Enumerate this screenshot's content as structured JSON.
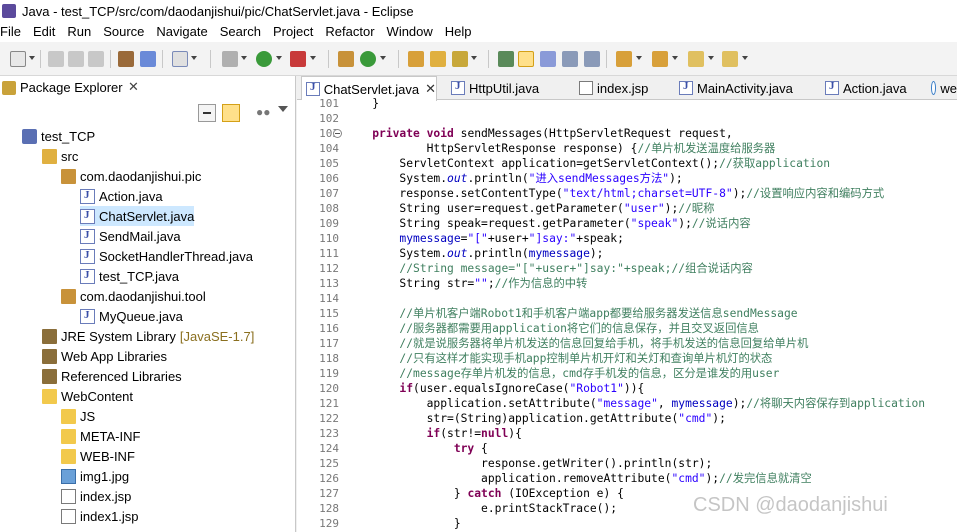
{
  "window": {
    "title": "Java - test_TCP/src/com/daodanjishui/pic/ChatServlet.java - Eclipse"
  },
  "menu": [
    "File",
    "Edit",
    "Run",
    "Source",
    "Navigate",
    "Search",
    "Project",
    "Refactor",
    "Window",
    "Help"
  ],
  "toolbar_icons": [
    "new-icon",
    "save-icon",
    "save-all-icon",
    "print-icon",
    "build-icon",
    "task-icon",
    "new-java-project-icon",
    "debug-icon",
    "run-icon",
    "external-tools-icon",
    "new-package-icon",
    "new-class-icon",
    "open-type-icon",
    "search-icon",
    "toggle-mark-icon",
    "highlight-icon",
    "show-whitespace-icon",
    "show-block-icon",
    "next-annotation-icon",
    "prev-annotation-icon",
    "back-icon",
    "forward-icon"
  ],
  "explorer": {
    "tab_label": "Package Explorer",
    "tree": [
      {
        "label": "test_TCP",
        "icon": "project-icon"
      },
      {
        "label": "src",
        "icon": "source-folder-icon"
      },
      {
        "label": "com.daodanjishui.pic",
        "icon": "package-icon"
      },
      {
        "label": "Action.java",
        "icon": "java-file-icon"
      },
      {
        "label": "ChatServlet.java",
        "icon": "java-file-icon"
      },
      {
        "label": "SendMail.java",
        "icon": "java-file-icon"
      },
      {
        "label": "SocketHandlerThread.java",
        "icon": "java-file-icon"
      },
      {
        "label": "test_TCP.java",
        "icon": "java-file-icon"
      },
      {
        "label": "com.daodanjishui.tool",
        "icon": "package-icon"
      },
      {
        "label": "MyQueue.java",
        "icon": "java-file-icon"
      },
      {
        "label": "JRE System Library",
        "suffix": "[JavaSE-1.7]",
        "icon": "library-icon"
      },
      {
        "label": "Web App Libraries",
        "icon": "library-icon"
      },
      {
        "label": "Referenced Libraries",
        "icon": "library-icon"
      },
      {
        "label": "WebContent",
        "icon": "folder-icon"
      },
      {
        "label": "JS",
        "icon": "folder-icon"
      },
      {
        "label": "META-INF",
        "icon": "folder-icon"
      },
      {
        "label": "WEB-INF",
        "icon": "folder-icon"
      },
      {
        "label": "img1.jpg",
        "icon": "image-file-icon"
      },
      {
        "label": "index.jsp",
        "icon": "jsp-file-icon"
      },
      {
        "label": "index1.jsp",
        "icon": "jsp-file-icon"
      }
    ]
  },
  "editor": {
    "tabs": [
      {
        "label": "ChatServlet.java",
        "active": true
      },
      {
        "label": "HttpUtil.java"
      },
      {
        "label": "index.jsp"
      },
      {
        "label": "MainActivity.java"
      },
      {
        "label": "Action.java"
      },
      {
        "label": "we"
      }
    ],
    "lines": [
      {
        "num": "101",
        "parts": [
          {
            "t": "    }",
            "c": ""
          }
        ]
      },
      {
        "num": "102",
        "parts": [
          {
            "t": "",
            "c": ""
          }
        ]
      },
      {
        "num": "103",
        "parts": [
          {
            "t": "    ",
            "c": ""
          },
          {
            "t": "private void",
            "c": "kw"
          },
          {
            "t": " sendMessages(HttpServletRequest request,",
            "c": ""
          }
        ]
      },
      {
        "num": "104",
        "parts": [
          {
            "t": "            HttpServletResponse response) {",
            "c": ""
          },
          {
            "t": "//单片机发送温度给服务器",
            "c": "cm"
          }
        ]
      },
      {
        "num": "105",
        "parts": [
          {
            "t": "        ServletContext application=getServletContext();",
            "c": ""
          },
          {
            "t": "//获取application",
            "c": "cm"
          }
        ]
      },
      {
        "num": "106",
        "parts": [
          {
            "t": "        System.",
            "c": ""
          },
          {
            "t": "out",
            "c": "sfld"
          },
          {
            "t": ".println(",
            "c": ""
          },
          {
            "t": "\"进入sendMessages方法\"",
            "c": "str"
          },
          {
            "t": ");",
            "c": ""
          }
        ]
      },
      {
        "num": "107",
        "parts": [
          {
            "t": "        response.setContentType(",
            "c": ""
          },
          {
            "t": "\"text/html;charset=UTF-8\"",
            "c": "str"
          },
          {
            "t": ");",
            "c": ""
          },
          {
            "t": "//设置响应内容和编码方式",
            "c": "cm"
          }
        ]
      },
      {
        "num": "108",
        "parts": [
          {
            "t": "        String user=request.getParameter(",
            "c": ""
          },
          {
            "t": "\"user\"",
            "c": "str"
          },
          {
            "t": ");",
            "c": ""
          },
          {
            "t": "//昵称",
            "c": "cm"
          }
        ]
      },
      {
        "num": "109",
        "parts": [
          {
            "t": "        String speak=request.getParameter(",
            "c": ""
          },
          {
            "t": "\"speak\"",
            "c": "str"
          },
          {
            "t": ");",
            "c": ""
          },
          {
            "t": "//说话内容",
            "c": "cm"
          }
        ]
      },
      {
        "num": "110",
        "parts": [
          {
            "t": "        ",
            "c": ""
          },
          {
            "t": "mymessage",
            "c": "fld"
          },
          {
            "t": "=",
            "c": ""
          },
          {
            "t": "\"[\"",
            "c": "str"
          },
          {
            "t": "+user+",
            "c": ""
          },
          {
            "t": "\"]say:\"",
            "c": "str"
          },
          {
            "t": "+speak;",
            "c": ""
          }
        ]
      },
      {
        "num": "111",
        "parts": [
          {
            "t": "        System.",
            "c": ""
          },
          {
            "t": "out",
            "c": "sfld"
          },
          {
            "t": ".println(",
            "c": ""
          },
          {
            "t": "mymessage",
            "c": "fld"
          },
          {
            "t": ");",
            "c": ""
          }
        ]
      },
      {
        "num": "112",
        "parts": [
          {
            "t": "        ",
            "c": ""
          },
          {
            "t": "//String message=\"[\"+user+\"]say:\"+speak;//组合说话内容",
            "c": "cm"
          }
        ]
      },
      {
        "num": "113",
        "parts": [
          {
            "t": "        String str=",
            "c": ""
          },
          {
            "t": "\"\"",
            "c": "str"
          },
          {
            "t": ";",
            "c": ""
          },
          {
            "t": "//作为信息的中转",
            "c": "cm"
          }
        ]
      },
      {
        "num": "114",
        "parts": [
          {
            "t": "",
            "c": ""
          }
        ]
      },
      {
        "num": "115",
        "parts": [
          {
            "t": "        ",
            "c": ""
          },
          {
            "t": "//单片机客户端Robot1和手机客户端app都要给服务器发送信息sendMessage",
            "c": "cm"
          }
        ]
      },
      {
        "num": "116",
        "parts": [
          {
            "t": "        ",
            "c": ""
          },
          {
            "t": "//服务器都需要用application将它们的信息保存，并且交叉返回信息",
            "c": "cm"
          }
        ]
      },
      {
        "num": "117",
        "parts": [
          {
            "t": "        ",
            "c": ""
          },
          {
            "t": "//就是说服务器将单片机发送的信息回复给手机，将手机发送的信息回复给单片机",
            "c": "cm"
          }
        ]
      },
      {
        "num": "118",
        "parts": [
          {
            "t": "        ",
            "c": ""
          },
          {
            "t": "//只有这样才能实现手机app控制单片机开灯和关灯和查询单片机灯的状态",
            "c": "cm"
          }
        ]
      },
      {
        "num": "119",
        "parts": [
          {
            "t": "        ",
            "c": ""
          },
          {
            "t": "//message存单片机发的信息，cmd存手机发的信息，区分是谁发的用user",
            "c": "cm"
          }
        ]
      },
      {
        "num": "120",
        "parts": [
          {
            "t": "        ",
            "c": ""
          },
          {
            "t": "if",
            "c": "kw"
          },
          {
            "t": "(user.equalsIgnoreCase(",
            "c": ""
          },
          {
            "t": "\"Robot1\"",
            "c": "str"
          },
          {
            "t": ")){",
            "c": ""
          }
        ]
      },
      {
        "num": "121",
        "parts": [
          {
            "t": "            application.setAttribute(",
            "c": ""
          },
          {
            "t": "\"message\"",
            "c": "str"
          },
          {
            "t": ", ",
            "c": ""
          },
          {
            "t": "mymessage",
            "c": "fld"
          },
          {
            "t": ");",
            "c": ""
          },
          {
            "t": "//将聊天内容保存到application",
            "c": "cm"
          }
        ]
      },
      {
        "num": "122",
        "parts": [
          {
            "t": "            str=(String)application.getAttribute(",
            "c": ""
          },
          {
            "t": "\"cmd\"",
            "c": "str"
          },
          {
            "t": ");",
            "c": ""
          }
        ]
      },
      {
        "num": "123",
        "parts": [
          {
            "t": "            ",
            "c": ""
          },
          {
            "t": "if",
            "c": "kw"
          },
          {
            "t": "(str!=",
            "c": ""
          },
          {
            "t": "null",
            "c": "kw"
          },
          {
            "t": "){",
            "c": ""
          }
        ]
      },
      {
        "num": "124",
        "parts": [
          {
            "t": "                ",
            "c": ""
          },
          {
            "t": "try",
            "c": "kw"
          },
          {
            "t": " {",
            "c": ""
          }
        ]
      },
      {
        "num": "125",
        "parts": [
          {
            "t": "                    response.getWriter().println(str);",
            "c": ""
          }
        ]
      },
      {
        "num": "126",
        "parts": [
          {
            "t": "                    application.removeAttribute(",
            "c": ""
          },
          {
            "t": "\"cmd\"",
            "c": "str"
          },
          {
            "t": ");",
            "c": ""
          },
          {
            "t": "//发完信息就清空",
            "c": "cm"
          }
        ]
      },
      {
        "num": "127",
        "parts": [
          {
            "t": "                } ",
            "c": ""
          },
          {
            "t": "catch",
            "c": "kw"
          },
          {
            "t": " (IOException e) {",
            "c": ""
          }
        ]
      },
      {
        "num": "128",
        "parts": [
          {
            "t": "                    e.printStackTrace();",
            "c": ""
          }
        ]
      },
      {
        "num": "129",
        "parts": [
          {
            "t": "                }",
            "c": ""
          }
        ]
      }
    ]
  },
  "watermark": "CSDN @daodanjishui"
}
